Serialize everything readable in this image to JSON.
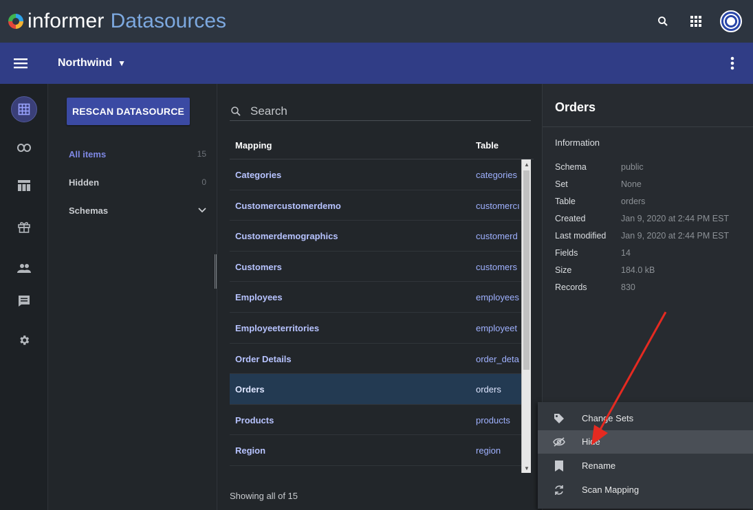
{
  "header": {
    "brand": "informer",
    "section": "Datasources"
  },
  "subbar": {
    "datasource": "Northwind"
  },
  "filters": {
    "rescan_label": "RESCAN DATASOURCE",
    "items": [
      {
        "label": "All items",
        "count": "15"
      },
      {
        "label": "Hidden",
        "count": "0"
      },
      {
        "label": "Schemas",
        "count": ""
      }
    ]
  },
  "list": {
    "search_placeholder": "Search",
    "col_mapping": "Mapping",
    "col_table": "Table",
    "rows": [
      {
        "mapping": "Categories",
        "table": "categories"
      },
      {
        "mapping": "Customercustomerdemo",
        "table": "customercı"
      },
      {
        "mapping": "Customerdemographics",
        "table": "customerd"
      },
      {
        "mapping": "Customers",
        "table": "customers"
      },
      {
        "mapping": "Employees",
        "table": "employees"
      },
      {
        "mapping": "Employeeterritories",
        "table": "employeet"
      },
      {
        "mapping": "Order Details",
        "table": "order_deta"
      },
      {
        "mapping": "Orders",
        "table": "orders"
      },
      {
        "mapping": "Products",
        "table": "products"
      },
      {
        "mapping": "Region",
        "table": "region"
      }
    ],
    "footer": "Showing all of 15"
  },
  "details": {
    "title": "Orders",
    "section": "Information",
    "fields": [
      {
        "key": "Schema",
        "value": "public"
      },
      {
        "key": "Set",
        "value": "None"
      },
      {
        "key": "Table",
        "value": "orders"
      },
      {
        "key": "Created",
        "value": "Jan 9, 2020 at 2:44 PM EST"
      },
      {
        "key": "Last modified",
        "value": "Jan 9, 2020 at 2:44 PM EST"
      },
      {
        "key": "Fields",
        "value": "14"
      },
      {
        "key": "Size",
        "value": "184.0 kB"
      },
      {
        "key": "Records",
        "value": "830"
      }
    ]
  },
  "menu": {
    "items": [
      {
        "label": "Change Sets",
        "icon": "tag-icon"
      },
      {
        "label": "Hide",
        "icon": "eye-off-icon"
      },
      {
        "label": "Rename",
        "icon": "bookmark-icon"
      },
      {
        "label": "Scan Mapping",
        "icon": "sync-icon"
      }
    ]
  },
  "colors": {
    "topbar": "#2d3540",
    "subbar": "#303d86",
    "accent": "#3b4aa3",
    "selected_row": "#233a52",
    "annotation_arrow": "#e52a21"
  }
}
